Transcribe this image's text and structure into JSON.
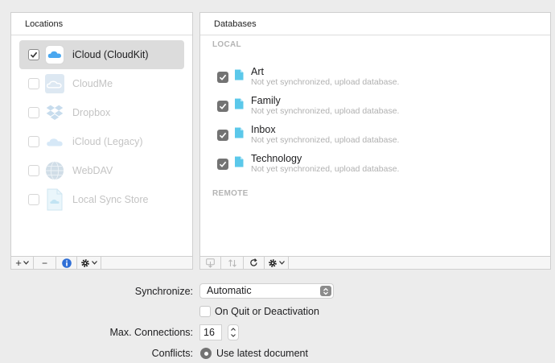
{
  "locations": {
    "header": "Locations",
    "items": [
      {
        "label": "iCloud (CloudKit)",
        "checked": true,
        "selected": true,
        "icon": "icloud-cloudkit-icon"
      },
      {
        "label": "CloudMe",
        "checked": false,
        "selected": false,
        "icon": "cloudme-icon"
      },
      {
        "label": "Dropbox",
        "checked": false,
        "selected": false,
        "icon": "dropbox-icon"
      },
      {
        "label": "iCloud (Legacy)",
        "checked": false,
        "selected": false,
        "icon": "icloud-legacy-icon"
      },
      {
        "label": "WebDAV",
        "checked": false,
        "selected": false,
        "icon": "webdav-globe-icon"
      },
      {
        "label": "Local Sync Store",
        "checked": false,
        "selected": false,
        "icon": "local-sync-store-icon"
      }
    ],
    "toolbar": {
      "add": "+",
      "remove": "−"
    }
  },
  "databases": {
    "header": "Databases",
    "local_heading": "LOCAL",
    "remote_heading": "REMOTE",
    "items": [
      {
        "name": "Art",
        "status": "Not yet synchronized, upload database.",
        "checked": true
      },
      {
        "name": "Family",
        "status": "Not yet synchronized, upload database.",
        "checked": true
      },
      {
        "name": "Inbox",
        "status": "Not yet synchronized, upload database.",
        "checked": true
      },
      {
        "name": "Technology",
        "status": "Not yet synchronized, upload database.",
        "checked": true
      }
    ]
  },
  "settings": {
    "synchronize_label": "Synchronize:",
    "synchronize_value": "Automatic",
    "on_quit_label": "On Quit or Deactivation",
    "on_quit_checked": false,
    "max_connections_label": "Max. Connections:",
    "max_connections_value": "16",
    "conflicts_label": "Conflicts:",
    "conflicts_value": "Use latest document"
  },
  "colors": {
    "icloud_blue": "#4aa8f0",
    "selected_row": "#dcdcdc",
    "info_blue": "#2f6fd6",
    "db_icon_cyan": "#5bc8ea"
  }
}
